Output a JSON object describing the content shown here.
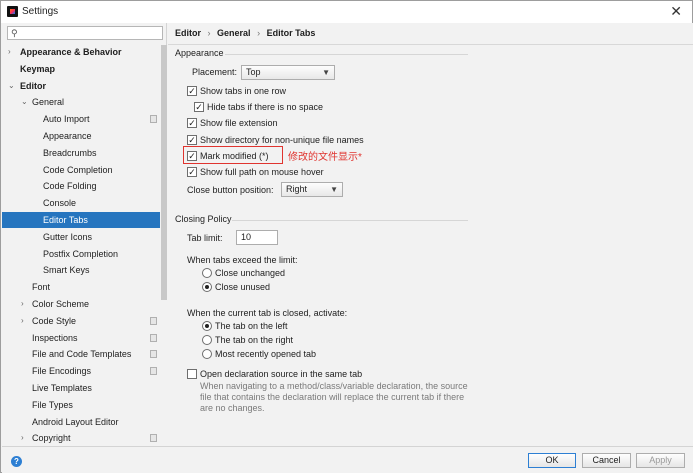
{
  "window": {
    "title": "Settings",
    "close_glyph": "✕"
  },
  "search": {
    "placeholder": "",
    "value": "",
    "icon": "search-icon"
  },
  "sidebar": {
    "items": [
      {
        "label": "Appearance & Behavior",
        "bold": true,
        "arrow": "›"
      },
      {
        "label": "Keymap",
        "bold": true,
        "arrow": ""
      },
      {
        "label": "Editor",
        "bold": true,
        "arrow": "⌄"
      },
      {
        "label": "General",
        "bold": false,
        "arrow": "⌄"
      },
      {
        "label": "Auto Import",
        "bold": false,
        "arrow": ""
      },
      {
        "label": "Appearance",
        "bold": false,
        "arrow": ""
      },
      {
        "label": "Breadcrumbs",
        "bold": false,
        "arrow": ""
      },
      {
        "label": "Code Completion",
        "bold": false,
        "arrow": ""
      },
      {
        "label": "Code Folding",
        "bold": false,
        "arrow": ""
      },
      {
        "label": "Console",
        "bold": false,
        "arrow": ""
      },
      {
        "label": "Editor Tabs",
        "bold": false,
        "arrow": "",
        "selected": true
      },
      {
        "label": "Gutter Icons",
        "bold": false,
        "arrow": ""
      },
      {
        "label": "Postfix Completion",
        "bold": false,
        "arrow": ""
      },
      {
        "label": "Smart Keys",
        "bold": false,
        "arrow": ""
      },
      {
        "label": "Font",
        "bold": false,
        "arrow": ""
      },
      {
        "label": "Color Scheme",
        "bold": false,
        "arrow": "›"
      },
      {
        "label": "Code Style",
        "bold": false,
        "arrow": "›"
      },
      {
        "label": "Inspections",
        "bold": false,
        "arrow": ""
      },
      {
        "label": "File and Code Templates",
        "bold": false,
        "arrow": ""
      },
      {
        "label": "File Encodings",
        "bold": false,
        "arrow": ""
      },
      {
        "label": "Live Templates",
        "bold": false,
        "arrow": ""
      },
      {
        "label": "File Types",
        "bold": false,
        "arrow": ""
      },
      {
        "label": "Android Layout Editor",
        "bold": false,
        "arrow": ""
      },
      {
        "label": "Copyright",
        "bold": false,
        "arrow": "›"
      }
    ]
  },
  "breadcrumb": {
    "items": [
      "Editor",
      "General",
      "Editor Tabs"
    ],
    "separator": "›"
  },
  "appearance": {
    "section_title": "Appearance",
    "placement_label": "Placement:",
    "placement_value": "Top",
    "show_tabs_one_row": {
      "label": "Show tabs in one row",
      "checked": true
    },
    "hide_tabs_no_space": {
      "label": "Hide tabs if there is no space",
      "checked": true
    },
    "show_file_extension": {
      "label": "Show file extension",
      "checked": true
    },
    "show_directory": {
      "label": "Show directory for non-unique file names",
      "checked": true
    },
    "mark_modified": {
      "label": "Mark modified (*)",
      "checked": true
    },
    "mark_modified_note": "修改的文件显示*",
    "show_full_path": {
      "label": "Show full path on mouse hover",
      "checked": true
    },
    "close_button_label": "Close button position:",
    "close_button_value": "Right"
  },
  "closing_policy": {
    "section_title": "Closing Policy",
    "tab_limit_label": "Tab limit:",
    "tab_limit_value": "10",
    "exceed_label": "When tabs exceed the limit:",
    "close_unchanged": {
      "label": "Close unchanged",
      "selected": false
    },
    "close_unused": {
      "label": "Close unused",
      "selected": true
    },
    "activate_label": "When the current tab is closed, activate:",
    "tab_left": {
      "label": "The tab on the left",
      "selected": true
    },
    "tab_right": {
      "label": "The tab on the right",
      "selected": false
    },
    "most_recent": {
      "label": "Most recently opened tab",
      "selected": false
    },
    "open_declaration": {
      "label": "Open declaration source in the same tab",
      "checked": false
    },
    "open_declaration_desc": "When navigating to a method/class/variable declaration, the source file that contains the declaration will replace the current tab if there are no changes."
  },
  "footer": {
    "help_glyph": "?",
    "ok_label": "OK",
    "cancel_label": "Cancel",
    "apply_label": "Apply"
  },
  "colors": {
    "selection": "#2675bf",
    "annotation": "#e0342f",
    "help": "#2d7fd3"
  }
}
